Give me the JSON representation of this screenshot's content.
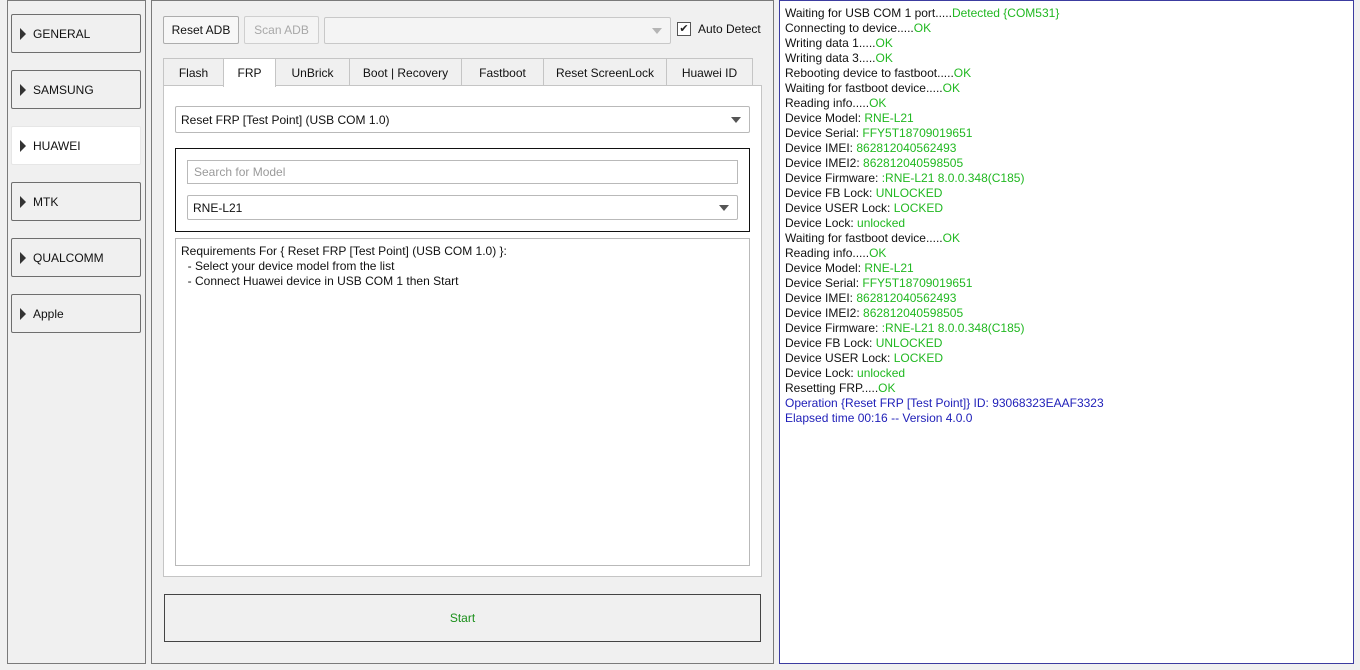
{
  "nav": {
    "items": [
      {
        "label": "GENERAL",
        "active": false
      },
      {
        "label": "SAMSUNG",
        "active": false
      },
      {
        "label": "HUAWEI",
        "active": true
      },
      {
        "label": "MTK",
        "active": false
      },
      {
        "label": "QUALCOMM",
        "active": false
      },
      {
        "label": "Apple",
        "active": false
      }
    ]
  },
  "toolbar": {
    "reset_adb_label": "Reset ADB",
    "scan_adb_label": "Scan ADB",
    "port_select_value": "",
    "auto_detect_label": "Auto Detect",
    "auto_detect_checked": true
  },
  "tabs": [
    {
      "label": "Flash",
      "active": false
    },
    {
      "label": "FRP",
      "active": true
    },
    {
      "label": "UnBrick",
      "active": false
    },
    {
      "label": "Boot | Recovery",
      "active": false
    },
    {
      "label": "Fastboot",
      "active": false
    },
    {
      "label": "Reset ScreenLock",
      "active": false
    },
    {
      "label": "Huawei ID",
      "active": false
    }
  ],
  "frp": {
    "operation_value": "Reset FRP [Test Point] (USB COM 1.0)",
    "search_placeholder": "Search for Model",
    "model_value": "RNE-L21",
    "requirements": [
      "Requirements For { Reset FRP [Test Point] (USB COM 1.0) }:",
      "  - Select your device model from the list",
      "  - Connect Huawei device in USB COM 1 then Start"
    ],
    "start_label": "Start"
  },
  "colors": {
    "ok_green": "#21b821",
    "info_blue": "#1e1eb8",
    "start_green": "#1a8f1a"
  },
  "log": [
    {
      "k": "Waiting for USB COM 1 port.....",
      "v": "Detected {COM531}"
    },
    {
      "k": "Connecting to device.....",
      "v": "OK"
    },
    {
      "k": "Writing data 1.....",
      "v": "OK"
    },
    {
      "k": "Writing data 3.....",
      "v": "OK"
    },
    {
      "k": "Rebooting device to fastboot.....",
      "v": "OK"
    },
    {
      "k": "Waiting for fastboot device.....",
      "v": "OK"
    },
    {
      "k": "Reading info.....",
      "v": "OK"
    },
    {
      "k": "Device Model: ",
      "v": "RNE-L21"
    },
    {
      "k": "Device Serial: ",
      "v": "FFY5T18709019651"
    },
    {
      "k": "Device IMEI: ",
      "v": "862812040562493"
    },
    {
      "k": "Device IMEI2: ",
      "v": "862812040598505"
    },
    {
      "k": "Device Firmware: ",
      "v": ":RNE-L21 8.0.0.348(C185)"
    },
    {
      "k": "Device FB Lock: ",
      "v": "UNLOCKED"
    },
    {
      "k": "Device USER Lock: ",
      "v": "LOCKED"
    },
    {
      "k": "Device Lock: ",
      "v": "unlocked"
    },
    {
      "k": "Waiting for fastboot device.....",
      "v": "OK"
    },
    {
      "k": "Reading info.....",
      "v": "OK"
    },
    {
      "k": "Device Model: ",
      "v": "RNE-L21"
    },
    {
      "k": "Device Serial: ",
      "v": "FFY5T18709019651"
    },
    {
      "k": "Device IMEI: ",
      "v": "862812040562493"
    },
    {
      "k": "Device IMEI2: ",
      "v": "862812040598505"
    },
    {
      "k": "Device Firmware: ",
      "v": ":RNE-L21 8.0.0.348(C185)"
    },
    {
      "k": "Device FB Lock: ",
      "v": "UNLOCKED"
    },
    {
      "k": "Device USER Lock: ",
      "v": "LOCKED"
    },
    {
      "k": "Device Lock: ",
      "v": "unlocked"
    },
    {
      "k": "Resetting FRP.....",
      "v": "OK"
    },
    {
      "k": "Operation {Reset FRP [Test Point]} ID: 93068323EAAF3323",
      "v": "",
      "style": "blue"
    },
    {
      "k": "Elapsed time 00:16 -- Version 4.0.0",
      "v": "",
      "style": "blue"
    }
  ]
}
